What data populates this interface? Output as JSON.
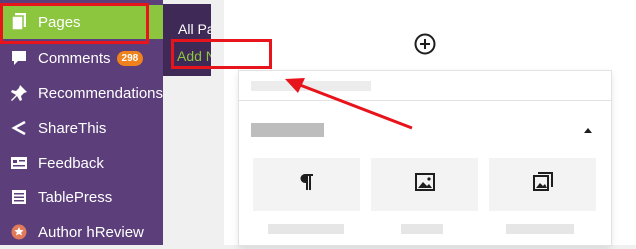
{
  "sidebar": {
    "items": [
      {
        "label": "Pages",
        "icon": "pages-icon",
        "active": true
      },
      {
        "label": "Comments",
        "icon": "comment-bubble-icon",
        "badge": "298"
      },
      {
        "label": "Recommendations",
        "icon": "pin-icon"
      },
      {
        "label": "ShareThis",
        "icon": "share-icon"
      },
      {
        "label": "Feedback",
        "icon": "feedback-icon"
      },
      {
        "label": "TablePress",
        "icon": "table-icon"
      },
      {
        "label": "Author hReview",
        "icon": "star-badge-icon"
      }
    ]
  },
  "flyout": {
    "items": [
      {
        "label": "All Pages"
      },
      {
        "label": "Add New"
      }
    ]
  },
  "editor": {
    "inserter_icon": "plus-circle-icon",
    "collapse_icon": "caret-up-icon",
    "blocks": [
      {
        "icon": "paragraph-icon"
      },
      {
        "icon": "image-icon"
      },
      {
        "icon": "gallery-icon"
      }
    ]
  },
  "colors": {
    "sidebar_bg": "#5b3e7a",
    "active_bg": "#8cc63f",
    "flyout_bg": "#3f2957",
    "highlight": "#e8141b",
    "badge": "#f0821e"
  }
}
